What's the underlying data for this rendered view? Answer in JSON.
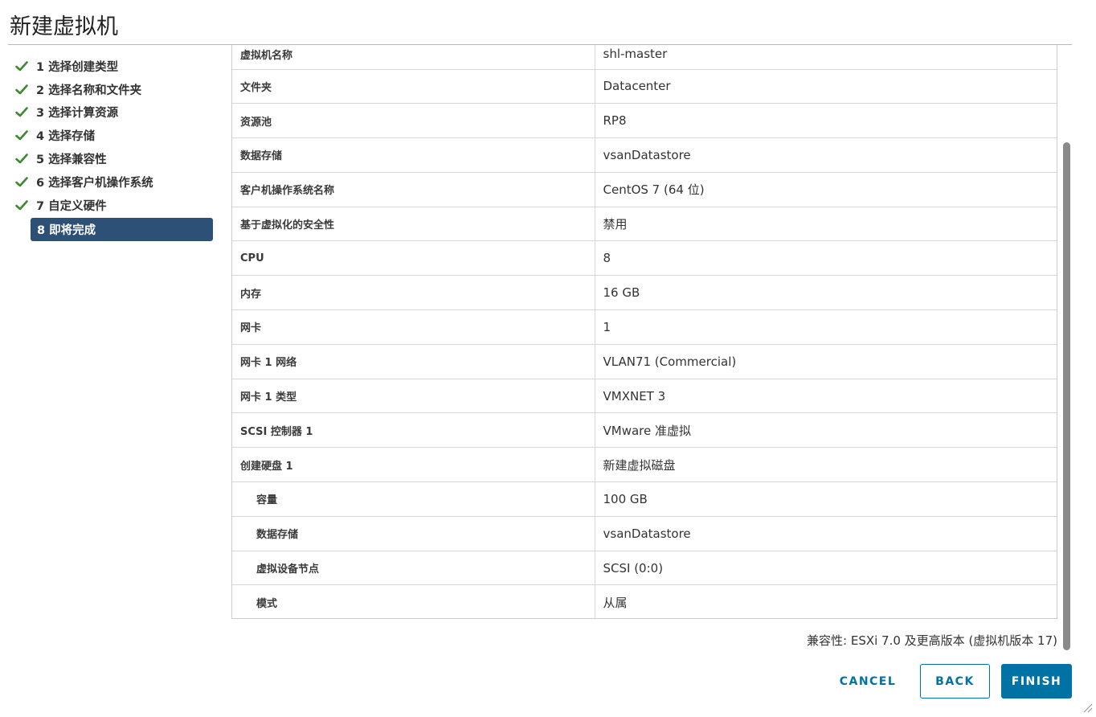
{
  "dialog": {
    "title": "新建虚拟机"
  },
  "steps": [
    {
      "label": "1 选择创建类型",
      "done": true
    },
    {
      "label": "2 选择名称和文件夹",
      "done": true
    },
    {
      "label": "3 选择计算资源",
      "done": true
    },
    {
      "label": "4 选择存储",
      "done": true
    },
    {
      "label": "5 选择兼容性",
      "done": true
    },
    {
      "label": "6 选择客户机操作系统",
      "done": true
    },
    {
      "label": "7 自定义硬件",
      "done": true
    },
    {
      "label": "8 即将完成",
      "done": false,
      "active": true
    }
  ],
  "summary": {
    "rows": [
      {
        "label": "虚拟机名称",
        "value": "shl-master"
      },
      {
        "label": "文件夹",
        "value": "Datacenter"
      },
      {
        "label": "资源池",
        "value": "RP8"
      },
      {
        "label": "数据存储",
        "value": "vsanDatastore"
      },
      {
        "label": "客户机操作系统名称",
        "value": "CentOS 7 (64 位)"
      },
      {
        "label": "基于虚拟化的安全性",
        "value": "禁用"
      },
      {
        "label": "CPU",
        "value": "8"
      },
      {
        "label": "内存",
        "value": "16 GB"
      },
      {
        "label": "网卡",
        "value": "1"
      },
      {
        "label": "网卡 1 网络",
        "value": "VLAN71 (Commercial)"
      },
      {
        "label": "网卡 1 类型",
        "value": "VMXNET 3"
      },
      {
        "label": "SCSI 控制器 1",
        "value": "VMware 准虚拟"
      },
      {
        "label": "创建硬盘 1",
        "value": "新建虚拟磁盘"
      },
      {
        "label": "容量",
        "value": "100 GB",
        "indent": true
      },
      {
        "label": "数据存储",
        "value": "vsanDatastore",
        "indent": true
      },
      {
        "label": "虚拟设备节点",
        "value": "SCSI (0:0)",
        "indent": true
      },
      {
        "label": "模式",
        "value": "从属",
        "indent": true
      }
    ]
  },
  "compatibility": "兼容性: ESXi 7.0 及更高版本 (虚拟机版本 17)",
  "buttons": {
    "cancel": "CANCEL",
    "back": "BACK",
    "finish": "FINISH"
  },
  "colors": {
    "accent": "#0072a3",
    "active_step": "#2d5077",
    "check": "#3c8a2e"
  },
  "icons": {
    "step_done": "check-icon"
  }
}
